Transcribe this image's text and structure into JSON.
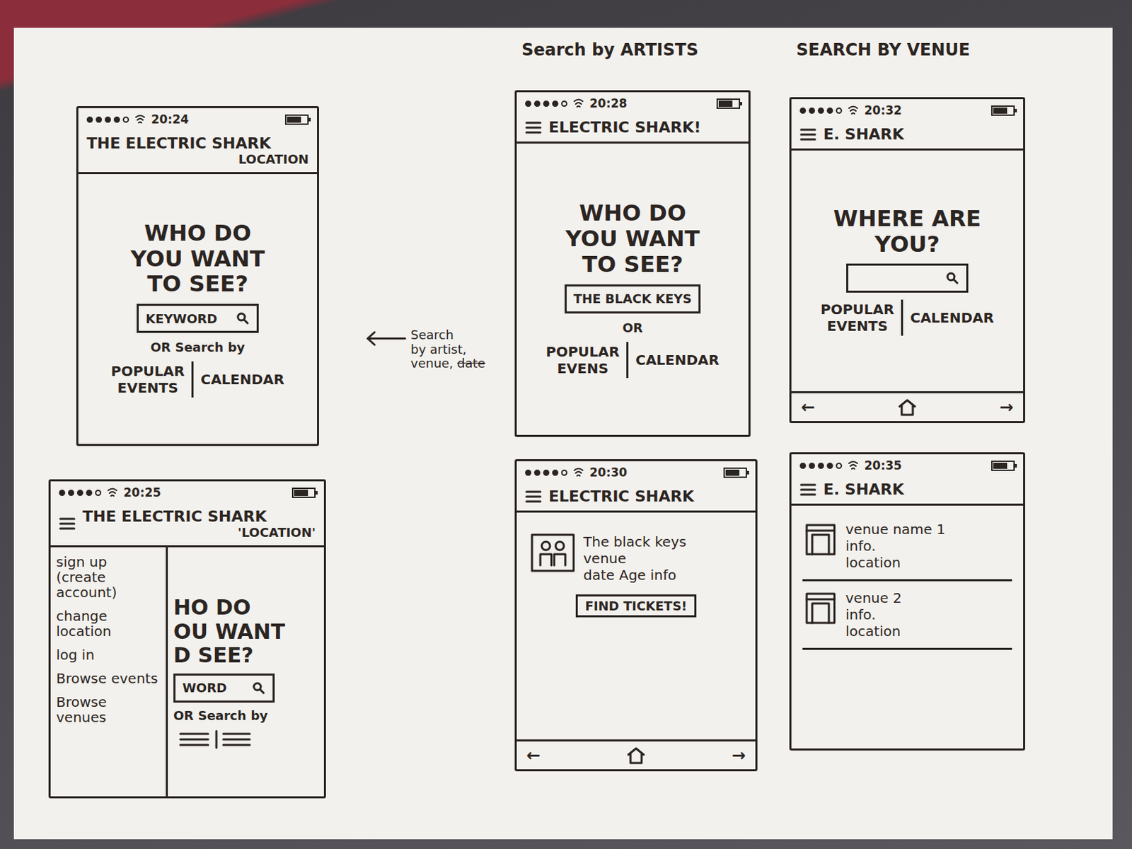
{
  "labels": {
    "artists": "Search by ARTISTS",
    "venue": "SEARCH BY VENUE"
  },
  "annotation": {
    "lines": [
      "Search",
      "by artist,",
      "venue,"
    ],
    "struck": "date"
  },
  "screens": [
    {
      "kind": "home",
      "time": "20:24",
      "signal": 4,
      "battery": 0.7,
      "menu": false,
      "title": "THE ELECTRIC SHARK",
      "subtitle": "LOCATION",
      "prompt": [
        "WHO DO",
        "YOU WANT",
        "TO SEE?"
      ],
      "search": "KEYWORD",
      "search_icon": true,
      "or_text": "OR Search by",
      "links": [
        "POPULAR EVENTS",
        "CALENDAR"
      ]
    },
    {
      "kind": "menu",
      "time": "20:25",
      "signal": 4,
      "battery": 0.7,
      "menu": true,
      "title": "THE ELECTRIC SHARK",
      "subtitle": "'LOCATION'",
      "items": [
        "sign up (create account)",
        "change location",
        "log in",
        "Browse events",
        "Browse venues"
      ],
      "prompt": [
        "HO DO",
        "OU WANT",
        "D SEE?"
      ],
      "search": "WORD",
      "search_icon": true,
      "or_text": "OR Search by"
    },
    {
      "kind": "home",
      "time": "20:28",
      "signal": 4,
      "battery": 0.7,
      "menu": true,
      "title": "ELECTRIC SHARK!",
      "prompt": [
        "WHO DO",
        "YOU WANT",
        "TO SEE?"
      ],
      "search": "THE BLACK KEYS",
      "search_icon": false,
      "or_text": "OR",
      "links": [
        "POPULAR EVENS",
        "CALENDAR"
      ]
    },
    {
      "kind": "event",
      "time": "20:30",
      "signal": 4,
      "battery": 0.7,
      "menu": true,
      "title": "ELECTRIC SHARK",
      "lines": [
        "The black keys",
        "venue",
        "date Age info"
      ],
      "button": "FIND TICKETS!",
      "nav": {
        "back": "←",
        "forward": "→"
      }
    },
    {
      "kind": "home",
      "time": "20:32",
      "signal": 4,
      "battery": 0.7,
      "menu": true,
      "title": "E. SHARK",
      "prompt": [
        "WHERE ARE",
        "YOU?"
      ],
      "search": "",
      "search_icon": true,
      "links": [
        "POPULAR EVENTS",
        "CALENDAR"
      ],
      "nav": {
        "back": "←",
        "forward": "→"
      }
    },
    {
      "kind": "venues",
      "time": "20:35",
      "signal": 4,
      "battery": 0.7,
      "menu": true,
      "title": "E. SHARK",
      "venues": [
        {
          "name": "venue name 1",
          "lines": [
            "info.",
            "location"
          ]
        },
        {
          "name": "venue 2",
          "lines": [
            "info.",
            "location"
          ]
        }
      ]
    }
  ]
}
